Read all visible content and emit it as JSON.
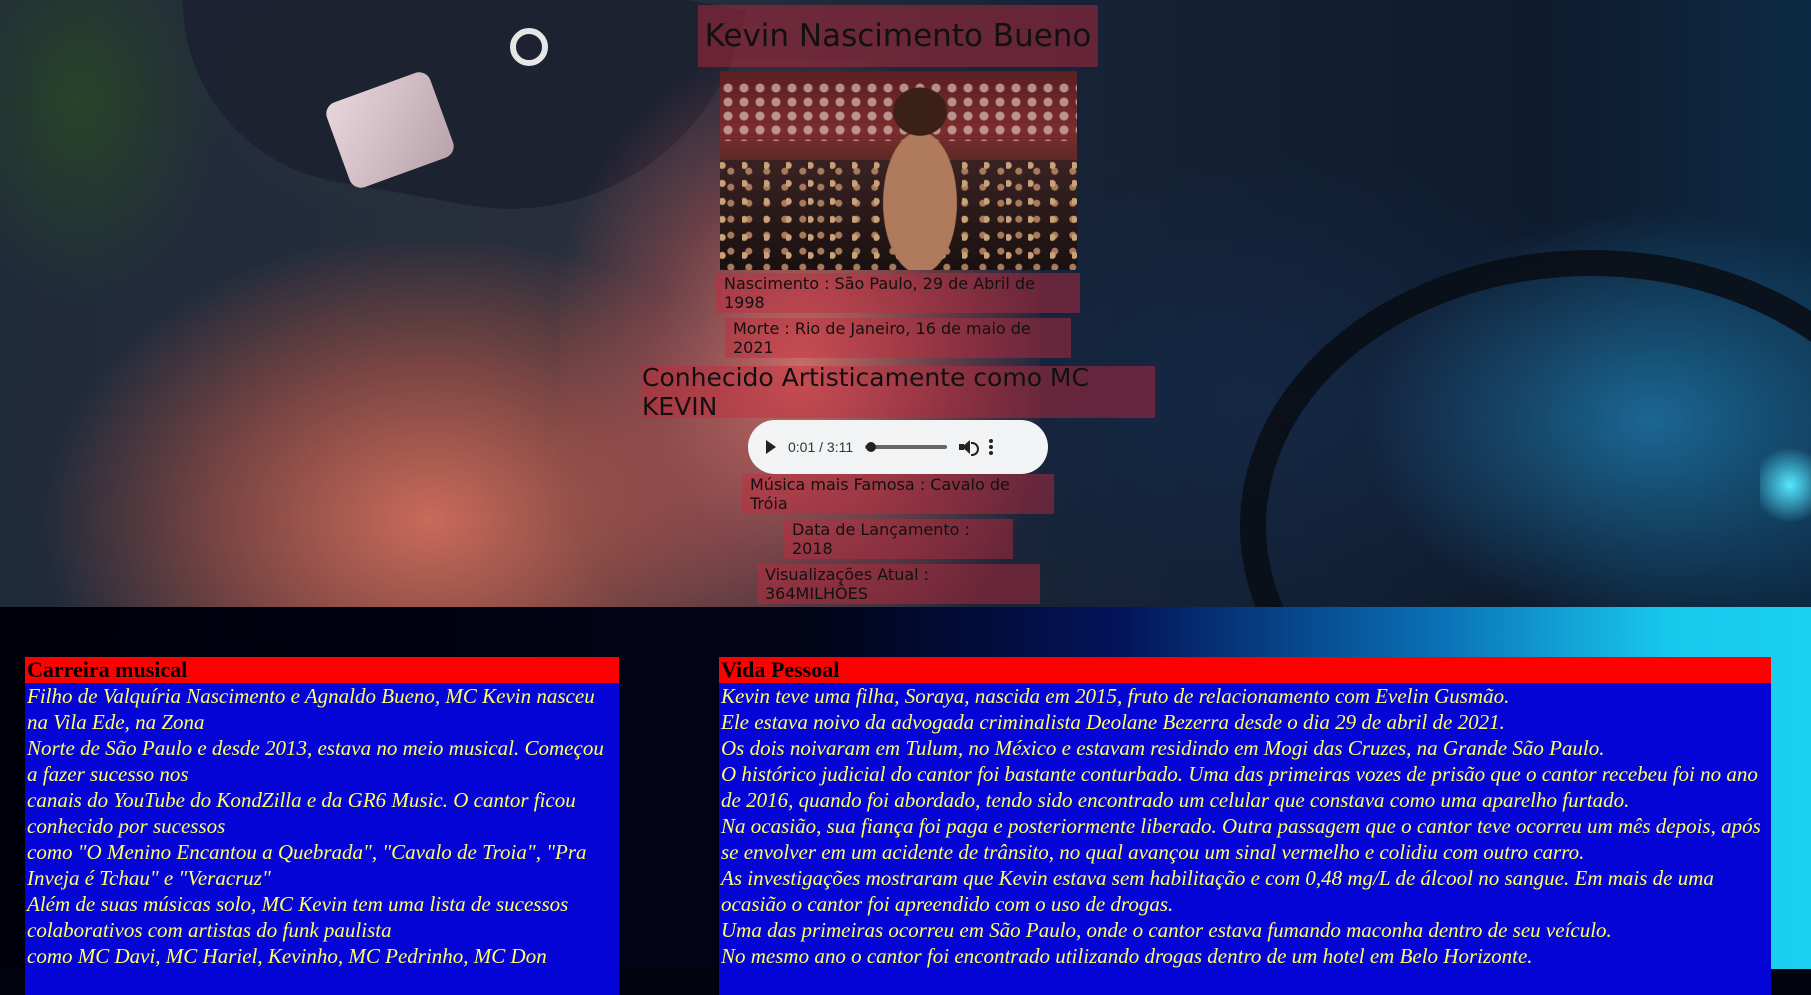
{
  "hero": {
    "title": "Kevin Nascimento Bueno",
    "birth": "Nascimento : São Paulo, 29 de Abril de 1998",
    "death": "Morte : Rio de Janeiro, 16 de maio de 2021",
    "subtitle": "Conhecido Artisticamente como MC KEVIN",
    "audio": {
      "time": "0:01 / 3:11",
      "progress": 0.005
    },
    "famous_song": "Música mais Famosa : Cavalo de Tróia",
    "release_date": "Data de Lançamento : 2018",
    "views": "Visualizações Atual : 364MILHÔES"
  },
  "career": {
    "heading": "Carreira musical",
    "lines": [
      "Filho de Valquíria Nascimento e Agnaldo Bueno, MC Kevin nasceu na Vila Ede, na Zona",
      "Norte de São Paulo e desde 2013, estava no meio musical. Começou a fazer sucesso nos",
      "canais do YouTube do KondZilla e da GR6 Music. O cantor ficou conhecido por sucessos",
      "como \"O Menino Encantou a Quebrada\", \"Cavalo de Troia\", \"Pra Inveja é Tchau\" e \"Veracruz\"",
      "Além de suas músicas solo, MC Kevin tem uma lista de sucessos colaborativos com artistas do funk paulista",
      "como MC Davi, MC Hariel, Kevinho, MC Pedrinho, MC Don"
    ]
  },
  "personal": {
    "heading": "Vida Pessoal",
    "lines": [
      "Kevin teve uma filha, Soraya, nascida em 2015, fruto de relacionamento com Evelin Gusmão.",
      "Ele estava noivo da advogada criminalista Deolane Bezerra desde o dia 29 de abril de 2021.",
      "Os dois noivaram em Tulum, no México e estavam residindo em Mogi das Cruzes, na Grande São Paulo.",
      "O histórico judicial do cantor foi bastante conturbado. Uma das primeiras vozes de prisão que o cantor recebeu foi no ano de 2016, quando foi abordado, tendo sido encontrado um celular que constava como uma aparelho furtado.",
      "Na ocasião, sua fiança foi paga e posteriormente liberado. Outra passagem que o cantor teve ocorreu um mês depois, após se envolver em um acidente de trânsito, no qual avançou um sinal vermelho e colidiu com outro carro.",
      "As investigações mostraram que Kevin estava sem habilitação e com 0,48 mg/L de álcool no sangue. Em mais de uma ocasião o cantor foi apreendido com o uso de drogas.",
      "Uma das primeiras ocorreu em São Paulo, onde o cantor estava fumando maconha dentro de seu veículo.",
      "No mesmo ano o cantor foi encontrado utilizando drogas dentro de um hotel em Belo Horizonte."
    ]
  },
  "colors": {
    "heading_bg": "#ff0000",
    "body_bg": "#0505d8",
    "body_text": "#ffff66"
  },
  "icons": [
    "play-icon",
    "volume-icon",
    "more-options-icon"
  ]
}
